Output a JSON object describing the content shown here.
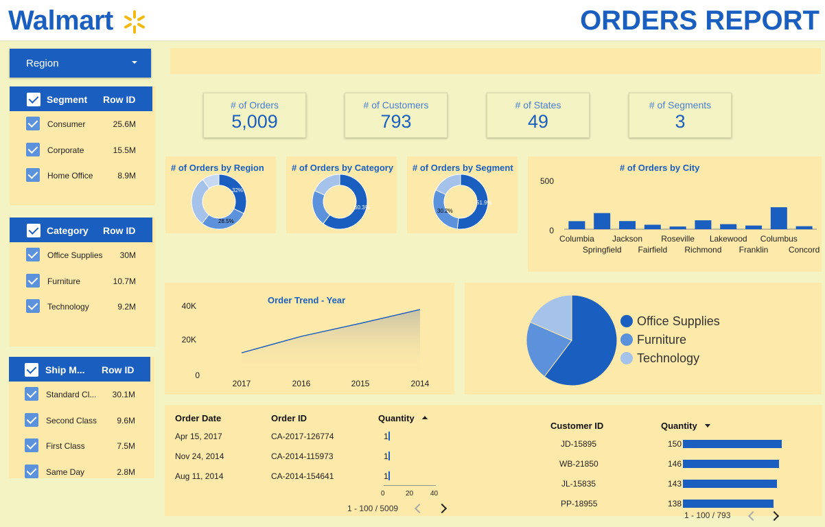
{
  "header": {
    "logo": "Walmart",
    "title": "ORDERS REPORT"
  },
  "colors": {
    "primary": "#1a5fbf",
    "mid": "#5b92db",
    "light": "#a4c2ea",
    "panel": "#fde9a9",
    "background": "#f3f3c4"
  },
  "region_filter": {
    "label": "Region"
  },
  "filters": [
    {
      "title": "Segment",
      "metric": "Row ID",
      "items": [
        {
          "label": "Consumer",
          "value": "25.6M"
        },
        {
          "label": "Corporate",
          "value": "15.5M"
        },
        {
          "label": "Home Office",
          "value": "8.9M"
        }
      ]
    },
    {
      "title": "Category",
      "metric": "Row ID",
      "items": [
        {
          "label": "Office Supplies",
          "value": "30M"
        },
        {
          "label": "Furniture",
          "value": "10.7M"
        },
        {
          "label": "Technology",
          "value": "9.2M"
        }
      ]
    },
    {
      "title": "Ship M...",
      "metric": "Row ID",
      "items": [
        {
          "label": "Standard Cl...",
          "value": "30.1M"
        },
        {
          "label": "Second Class",
          "value": "9.6M"
        },
        {
          "label": "First Class",
          "value": "7.5M"
        },
        {
          "label": "Same Day",
          "value": "2.8M"
        }
      ]
    }
  ],
  "kpis": [
    {
      "label": "# of Orders",
      "value": "5,009"
    },
    {
      "label": "# of Customers",
      "value": "793"
    },
    {
      "label": "# of States",
      "value": "49"
    },
    {
      "label": "# of Segments",
      "value": "3"
    }
  ],
  "chart_data": [
    {
      "type": "pie",
      "title": "# of Orders by Region",
      "donut": true,
      "slices": [
        {
          "value": 32
        },
        {
          "value": 28.5
        },
        {
          "value": 29.5
        },
        {
          "value": 10
        }
      ],
      "data_labels": [
        "32%",
        "28.5%"
      ]
    },
    {
      "type": "pie",
      "title": "# of Orders by Category",
      "donut": true,
      "slices": [
        {
          "value": 60.3
        },
        {
          "value": 21.3
        },
        {
          "value": 18.4
        }
      ],
      "data_labels": [
        "60.3%"
      ]
    },
    {
      "type": "pie",
      "title": "# of Orders by Segment",
      "donut": true,
      "slices": [
        {
          "value": 51.9
        },
        {
          "value": 30.2
        },
        {
          "value": 17.9
        }
      ],
      "data_labels": [
        "51.9%",
        "30.2%"
      ]
    },
    {
      "type": "bar",
      "title": "# of Orders by City",
      "categories": [
        "Columbia",
        "Springfield",
        "Jackson",
        "Fairfield",
        "Roseville",
        "Richmond",
        "Lakewood",
        "Franklin",
        "Columbus",
        "Concord"
      ],
      "values": [
        81,
        163,
        82,
        45,
        27,
        90,
        51,
        37,
        222,
        30
      ],
      "ylim": [
        0,
        500
      ],
      "yticks": [
        "500",
        "0"
      ],
      "grid": false
    },
    {
      "type": "area",
      "title": "Order Trend - Year",
      "x": [
        "2017",
        "2016",
        "2015",
        "2014"
      ],
      "values": [
        13000,
        22500,
        30000,
        38000
      ],
      "ylim": [
        0,
        40000
      ],
      "yticks": [
        "40K",
        "20K",
        "0"
      ]
    },
    {
      "type": "pie",
      "title": "",
      "series": [
        {
          "name": "Office Supplies",
          "value": 60.3
        },
        {
          "name": "Furniture",
          "value": 21.3
        },
        {
          "name": "Technology",
          "value": 18.4
        }
      ],
      "legend": "right"
    }
  ],
  "orders_table": {
    "headers": [
      "Order Date",
      "Order ID",
      "Quantity"
    ],
    "rows": [
      {
        "date": "Apr 15, 2017",
        "id": "CA-2017-126774",
        "qty": "1"
      },
      {
        "date": "Nov 24, 2014",
        "id": "CA-2014-115973",
        "qty": "1"
      },
      {
        "date": "Aug 11, 2014",
        "id": "CA-2014-154641",
        "qty": "1"
      }
    ],
    "axis_ticks": [
      "0",
      "20",
      "40"
    ],
    "pagination": "1 - 100 / 5009"
  },
  "customers_table": {
    "headers": [
      "Customer ID",
      "Quantity"
    ],
    "rows": [
      {
        "id": "JD-15895",
        "qty": 150
      },
      {
        "id": "WB-21850",
        "qty": 146
      },
      {
        "id": "JL-15835",
        "qty": 143
      },
      {
        "id": "PP-18955",
        "qty": 138
      }
    ],
    "pagination": "1 - 100 / 793"
  }
}
